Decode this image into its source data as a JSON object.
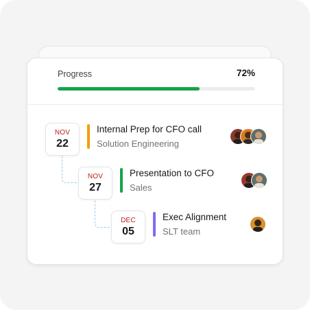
{
  "progress": {
    "label": "Progress",
    "value_text": "72%",
    "fraction": 0.72,
    "color": "#16a34a"
  },
  "events": [
    {
      "month": "NOV",
      "day": "22",
      "title": "Internal Prep for CFO call",
      "subtitle": "Solution Engineering",
      "accent": "#f59e0b",
      "avatars": [
        "avatar-person-icon",
        "avatar-person-icon",
        "avatar-person-icon"
      ]
    },
    {
      "month": "NOV",
      "day": "27",
      "title": "Presentation to CFO",
      "subtitle": "Sales",
      "accent": "#16a34a",
      "avatars": [
        "avatar-person-icon",
        "avatar-person-icon"
      ]
    },
    {
      "month": "DEC",
      "day": "05",
      "title": "Exec Alignment",
      "subtitle": "SLT team",
      "accent": "#7c6cf0",
      "avatars": [
        "avatar-person-icon"
      ]
    }
  ]
}
